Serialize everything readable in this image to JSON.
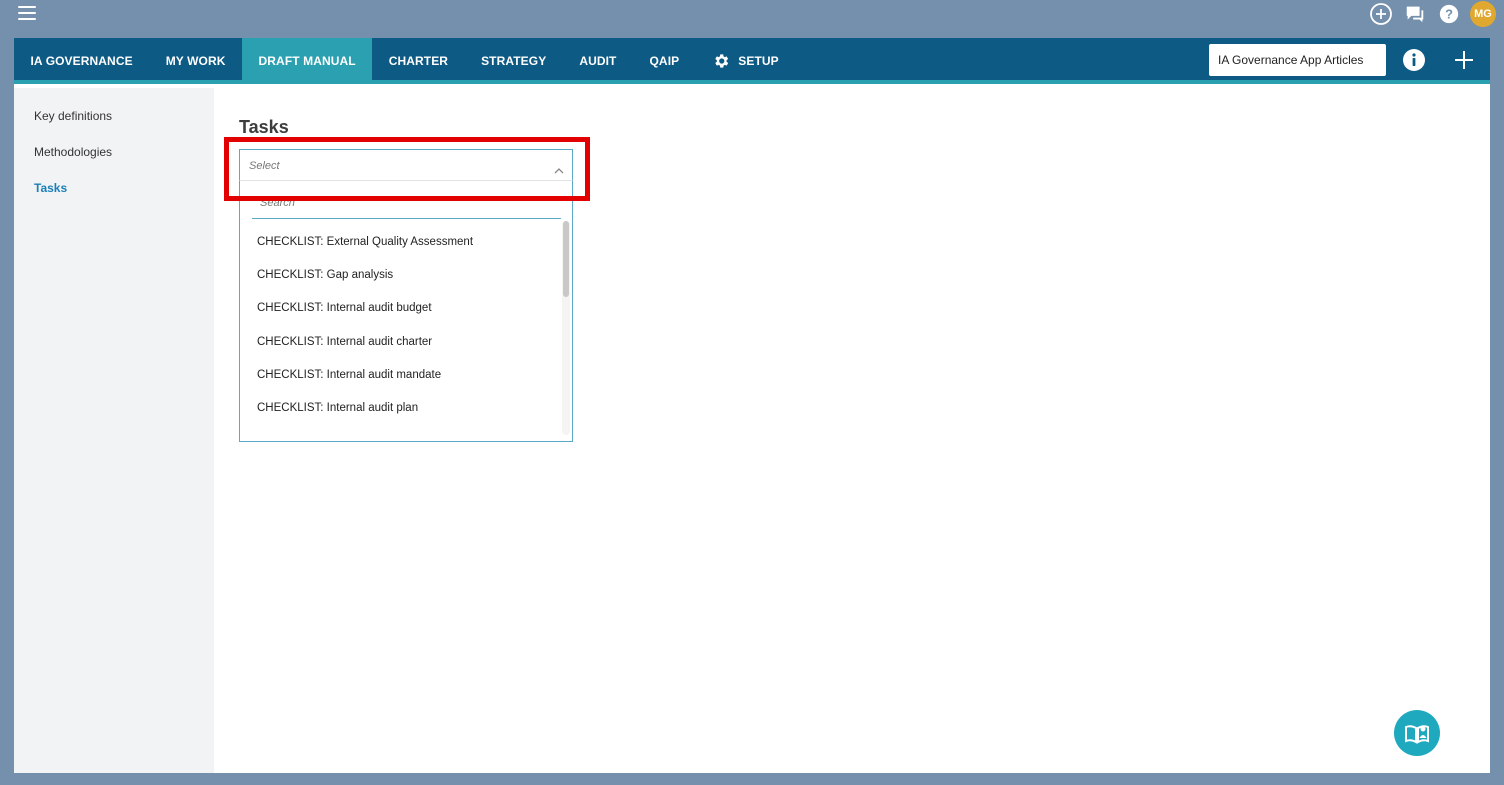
{
  "topbar": {
    "menu_icon": "hamburger-menu-icon",
    "icons": [
      "plus-circle-icon",
      "chat-icon",
      "help-icon"
    ],
    "avatar_initials": "MG",
    "avatar_color": "#e0a82e"
  },
  "nav": {
    "tabs": [
      {
        "label": "IA GOVERNANCE"
      },
      {
        "label": "MY WORK"
      },
      {
        "label": "DRAFT MANUAL",
        "active": true
      },
      {
        "label": "CHARTER"
      },
      {
        "label": "STRATEGY"
      },
      {
        "label": "AUDIT"
      },
      {
        "label": "QAIP"
      },
      {
        "label": "SETUP",
        "icon": "gear-icon"
      }
    ],
    "articles_label": "IA Governance App Articles",
    "info_icon": "info-icon",
    "add_icon": "plus-icon",
    "bar_color": "#0d5a85",
    "active_color": "#2aa0b0"
  },
  "sidebar": {
    "items": [
      {
        "label": "Key definitions"
      },
      {
        "label": "Methodologies"
      },
      {
        "label": "Tasks",
        "active": true
      }
    ]
  },
  "main": {
    "title": "Tasks",
    "select": {
      "placeholder": "Select",
      "search_placeholder": "Search",
      "options": [
        "CHECKLIST: External Quality Assessment",
        "CHECKLIST: Gap analysis",
        "CHECKLIST: Internal audit budget",
        "CHECKLIST: Internal audit charter",
        "CHECKLIST: Internal audit mandate",
        "CHECKLIST: Internal audit plan"
      ]
    }
  },
  "highlight_color": "#e20000",
  "fab_icon": "book-reader-icon"
}
